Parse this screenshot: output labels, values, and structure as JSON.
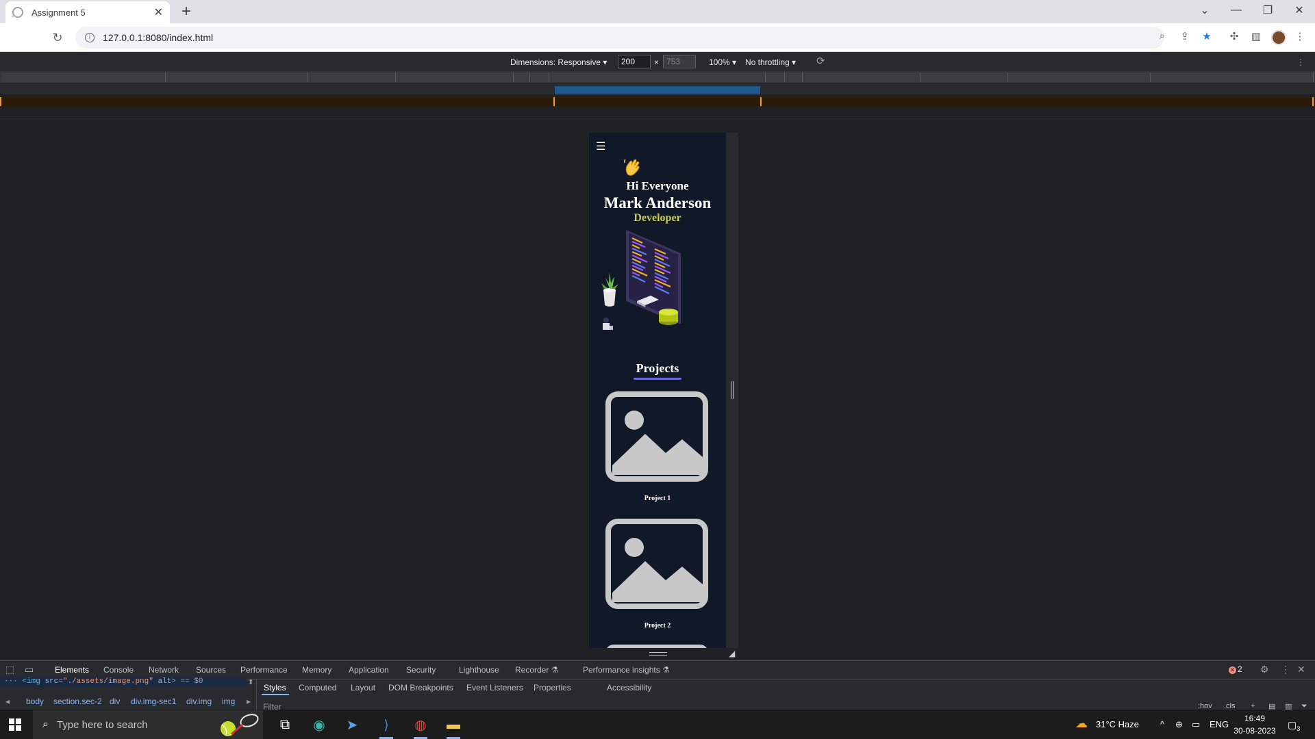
{
  "browser": {
    "tab_title": "Assignment 5",
    "url": "127.0.0.1:8080/index.html"
  },
  "device_toolbar": {
    "dimensions_label": "Dimensions: Responsive",
    "width": "200",
    "height": "753",
    "times": "×",
    "zoom": "100%",
    "throttle": "No throttling"
  },
  "page": {
    "greeting": "Hi Everyone",
    "name": "Mark Anderson",
    "role": "Developer",
    "projects_heading": "Projects",
    "projects": [
      {
        "label": "Project 1"
      },
      {
        "label": "Project 2"
      }
    ],
    "colors": {
      "background": "#111827",
      "role": "#c7c95a",
      "underline": "#6b6bd6"
    }
  },
  "devtools": {
    "tabs": [
      "Elements",
      "Console",
      "Network",
      "Sources",
      "Performance",
      "Memory",
      "Application",
      "Security",
      "Lighthouse",
      "Recorder",
      "Performance insights"
    ],
    "error_count": "2",
    "selected_code": {
      "tag": "<img",
      "attr_src": "src=",
      "src_val": "\"./assets/image.png\"",
      "attr_alt": "alt",
      "suffix": "> == $0"
    },
    "breadcrumbs": [
      "body",
      "section.sec-2",
      "div",
      "div.img-sec1",
      "div.img",
      "img"
    ],
    "sub_tabs": [
      "Styles",
      "Computed",
      "Layout",
      "DOM Breakpoints",
      "Event Listeners",
      "Properties",
      "Accessibility"
    ],
    "filter_placeholder": "Filter",
    "hov": ":hov",
    "cls": ".cls"
  },
  "taskbar": {
    "search_placeholder": "Type here to search",
    "weather": "31°C Haze",
    "language": "ENG",
    "time": "16:49",
    "date": "30-08-2023",
    "notifications": "3"
  }
}
